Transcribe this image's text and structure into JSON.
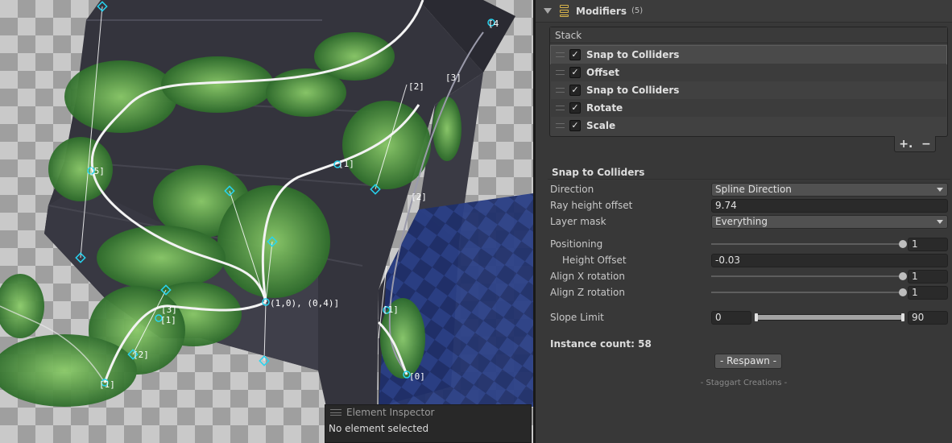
{
  "scene": {
    "point_labels": [
      "[2]",
      "[3]",
      "[1]",
      "[5]",
      "[2]",
      "[1]",
      "[3]",
      "(1,0), (0,4)]",
      "[1]",
      "[0]",
      "[2]",
      "[1]",
      "[4"
    ],
    "element_inspector": {
      "title": "Element Inspector",
      "message": "No element selected"
    }
  },
  "modifiers": {
    "title": "Modifiers",
    "count": "(5)",
    "stack_header": "Stack",
    "items": [
      {
        "label": "Snap to Colliders",
        "checked": true
      },
      {
        "label": "Offset",
        "checked": true
      },
      {
        "label": "Snap to Colliders",
        "checked": true
      },
      {
        "label": "Rotate",
        "checked": true
      },
      {
        "label": "Scale",
        "checked": true
      }
    ],
    "add_symbol": "+.",
    "remove_symbol": "−"
  },
  "settings": {
    "section_title": "Snap to Colliders",
    "direction": {
      "label": "Direction",
      "value": "Spline Direction"
    },
    "ray_height_offset": {
      "label": "Ray height offset",
      "value": "9.74"
    },
    "layer_mask": {
      "label": "Layer mask",
      "value": "Everything"
    },
    "positioning": {
      "label": "Positioning",
      "value": "1",
      "fraction": 1.0
    },
    "height_offset": {
      "label": "Height Offset",
      "value": "-0.03"
    },
    "align_x": {
      "label": "Align X rotation",
      "value": "1",
      "fraction": 1.0
    },
    "align_z": {
      "label": "Align Z rotation",
      "value": "1",
      "fraction": 1.0
    },
    "slope_limit": {
      "label": "Slope Limit",
      "min": "0",
      "max": "90"
    }
  },
  "instance_count": "Instance count: 58",
  "respawn_label": "- Respawn -",
  "credits": "- Staggart Creations -"
}
